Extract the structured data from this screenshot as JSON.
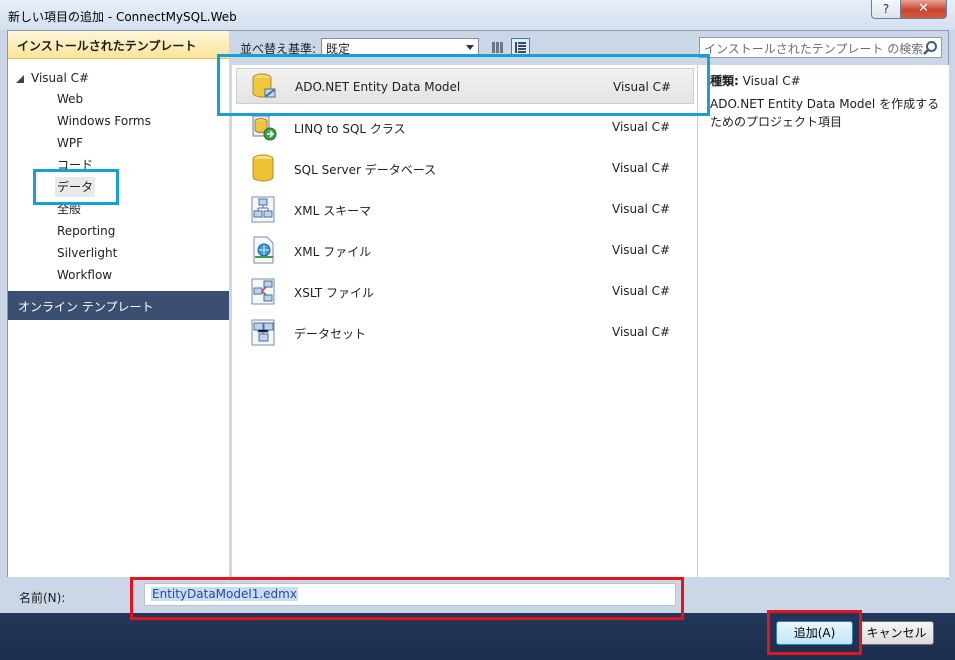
{
  "window": {
    "title": "新しい項目の追加 - ConnectMySQL.Web",
    "help_label": "?",
    "close_label": "✕"
  },
  "left_panel": {
    "installed_header": "インストールされたテンプレート",
    "tree_root": "Visual C#",
    "tree_items": [
      "Web",
      "Windows Forms",
      "WPF",
      "コード",
      "データ",
      "全般",
      "Reporting",
      "Silverlight",
      "Workflow"
    ],
    "selected_item": "データ",
    "online_header": "オンライン テンプレート"
  },
  "toolbar": {
    "sort_label": "並べ替え基準:",
    "sort_value": "既定"
  },
  "search": {
    "placeholder": "インストールされたテンプレート の検索"
  },
  "templates": [
    {
      "name": "ADO.NET Entity Data Model",
      "lang": "Visual C#",
      "icon": "entity-model-icon",
      "selected": true
    },
    {
      "name": "LINQ to SQL クラス",
      "lang": "Visual C#",
      "icon": "linq-to-sql-icon",
      "selected": false
    },
    {
      "name": "SQL Server データベース",
      "lang": "Visual C#",
      "icon": "database-icon",
      "selected": false
    },
    {
      "name": "XML スキーマ",
      "lang": "Visual C#",
      "icon": "xml-schema-icon",
      "selected": false
    },
    {
      "name": "XML ファイル",
      "lang": "Visual C#",
      "icon": "xml-file-icon",
      "selected": false
    },
    {
      "name": "XSLT ファイル",
      "lang": "Visual C#",
      "icon": "xslt-file-icon",
      "selected": false
    },
    {
      "name": "データセット",
      "lang": "Visual C#",
      "icon": "dataset-icon",
      "selected": false
    }
  ],
  "details": {
    "kind_label": "種類:",
    "kind_value": "Visual C#",
    "description": "ADO.NET Entity Data Model を作成するためのプロジェクト項目"
  },
  "name_field": {
    "label": "名前(N):",
    "value": "EntityDataModel1.edmx"
  },
  "buttons": {
    "add": "追加(A)",
    "cancel": "キャンセル"
  },
  "colors": {
    "highlight_blue": "#17a0d8",
    "highlight_red": "#e3141c",
    "footer": "#1f3152",
    "installed_header": "#fbe49a"
  }
}
